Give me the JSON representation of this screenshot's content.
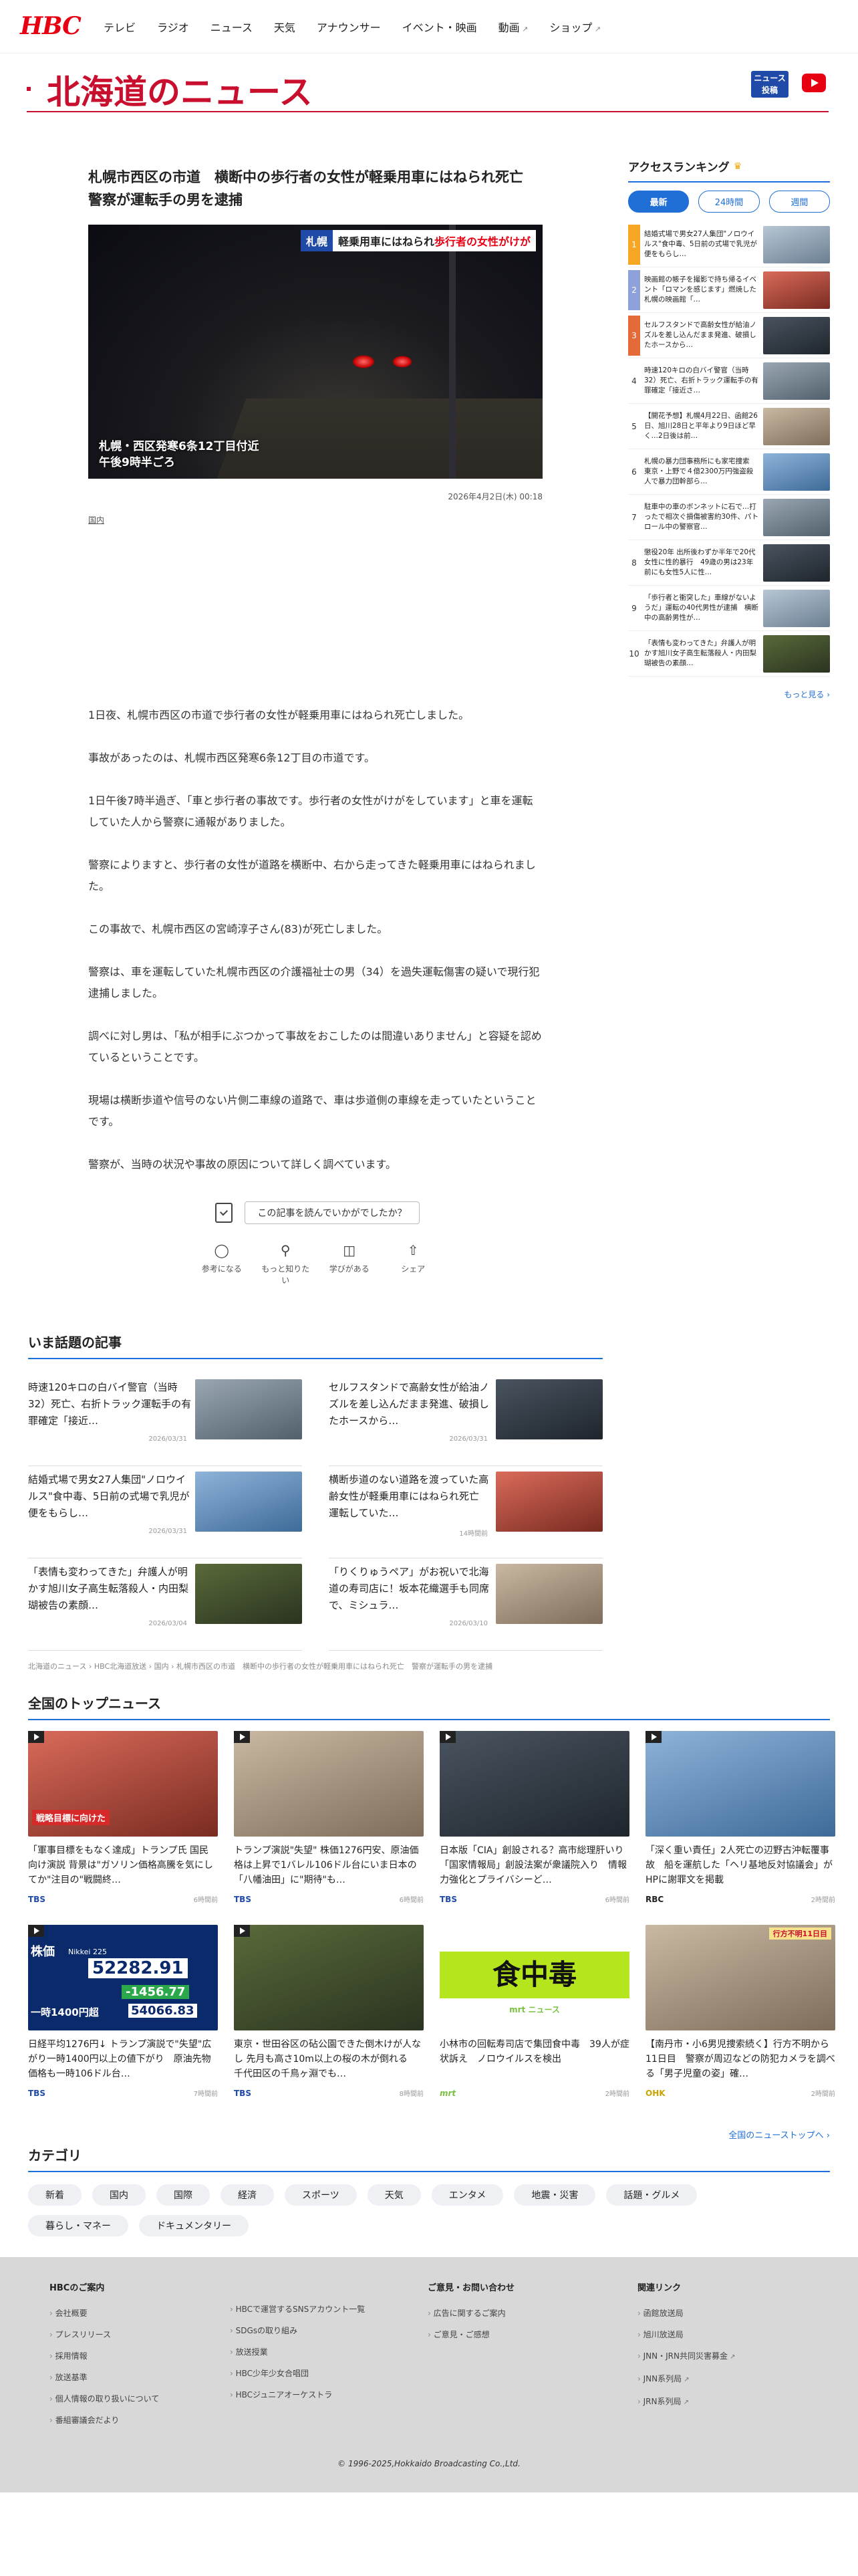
{
  "header": {
    "logo": "HBC",
    "nav": [
      "テレビ",
      "ラジオ",
      "ニュース",
      "天気",
      "アナウンサー",
      "イベント・映画",
      "動画",
      "ショップ"
    ]
  },
  "section_title": "北海道のニュース",
  "news_post_button": "ニュース\n投稿",
  "article": {
    "headline": "札幌市西区の市道　横断中の歩行者の女性が軽乗用車にはねられ死亡　警察が運転手の男を逮捕",
    "image": {
      "tag_area": "札幌",
      "tag_text_1": "軽乗用車にはねられ",
      "tag_text_2": "歩行者の女性がけが",
      "location_line1": "札幌・西区発寒6条12丁目付近",
      "location_line2": "午後9時半ごろ"
    },
    "published": "2026年4月2日(木) 00:18",
    "category": "国内",
    "paragraphs": [
      "1日夜、札幌市西区の市道で歩行者の女性が軽乗用車にはねられ死亡しました。",
      "事故があったのは、札幌市西区発寒6条12丁目の市道です。",
      "1日午後7時半過ぎ、「車と歩行者の事故です。歩行者の女性がけがをしています」と車を運転していた人から警察に通報がありました。",
      "警察によりますと、歩行者の女性が道路を横断中、右から走ってきた軽乗用車にはねられました。",
      "この事故で、札幌市西区の宮崎淳子さん(83)が死亡しました。",
      "警察は、車を運転していた札幌市西区の介護福祉士の男（34）を過失運転傷害の疑いで現行犯逮捕しました。",
      "調べに対し男は、「私が相手にぶつかって事故をおこしたのは間違いありません」と容疑を認めているということです。",
      "現場は横断歩道や信号のない片側二車線の道路で、車は歩道側の車線を走っていたということです。",
      "警察が、当時の状況や事故の原因について詳しく調べています。"
    ]
  },
  "reaction": {
    "question": "この記事を読んでいかがでしたか？",
    "buttons": [
      "参考になる",
      "もっと知りたい",
      "学びがある",
      "シェア"
    ]
  },
  "ranking": {
    "title": "アクセスランキング",
    "tabs": [
      "最新",
      "24時間",
      "週間"
    ],
    "items": [
      {
        "rank": "1",
        "text": "結婚式場で男女27人集団\"ノロウイルス\"食中毒、5日前の式場で乳児が便をもらし…"
      },
      {
        "rank": "2",
        "text": "映画館の帳子を撮影で持ち帰るイベント「ロマンを感じます」燃焼した札幌の映画館「…"
      },
      {
        "rank": "3",
        "text": "セルフスタンドで高齢女性が給油ノズルを差し込んだまま発進、破損したホースから…"
      },
      {
        "rank": "4",
        "text": "時速120キロの白バイ警官（当時32）死亡、右折トラック運転手の有罪確定「接近さ…"
      },
      {
        "rank": "5",
        "text": "【開花予想】札幌4月22日、函館26日、旭川28日と平年より9日ほど早く…2日後は前…"
      },
      {
        "rank": "6",
        "text": "札幌の暴力団事務所にも家宅捜索　東京・上野で４億2300万円強盗殺人で暴力団幹部ら…"
      },
      {
        "rank": "7",
        "text": "駐車中の車のボンネットに石で…打ったで相次ぐ損傷被害約30件、パトロール中の警察官…"
      },
      {
        "rank": "8",
        "text": "懲役20年 出所後わずか半年で20代女性に性的暴行　49歳の男は23年前にも女性5人に性…"
      },
      {
        "rank": "9",
        "text": "「歩行者と衝突した」車線がないようだ」運転の40代男性が逮捕　横断中の高齢男性が…"
      },
      {
        "rank": "10",
        "text": "「表情も変わってきた」弁護人が明かす旭川女子高生転落殺人・内田梨瑚被告の素顔…"
      }
    ],
    "more": "もっと見る"
  },
  "trending": {
    "title": "いま話題の記事",
    "items": [
      {
        "text": "時速120キロの白バイ警官（当時32）死亡、右折トラック運転手の有罪確定「接近…",
        "date": "2026/03/31"
      },
      {
        "text": "セルフスタンドで高齢女性が給油ノズルを差し込んだまま発進、破損したホースから…",
        "date": "2026/03/31"
      },
      {
        "text": "結婚式場で男女27人集団\"ノロウイルス\"食中毒、5日前の式場で乳児が便をもらし…",
        "date": "2026/03/31"
      },
      {
        "text": "横断歩道のない道路を渡っていた高齢女性が軽乗用車にはねられ死亡　運転していた…",
        "date": "14時間前"
      },
      {
        "text": "「表情も変わってきた」弁護人が明かす旭川女子高生転落殺人・内田梨瑚被告の素顔…",
        "date": "2026/03/04"
      },
      {
        "text": "「りくりゅうペア」がお祝いで北海道の寿司店に！坂本花織選手も同席で、ミシュラ…",
        "date": "2026/03/10"
      }
    ]
  },
  "breadcrumb": [
    "北海道のニュース",
    "HBC北海道放送",
    "国内",
    "札幌市西区の市道　横断中の歩行者の女性が軽乗用車にはねられ死亡　警察が運転手の男を逮捕"
  ],
  "national": {
    "title": "全国のトップニュース",
    "items": [
      {
        "text": "「軍事目標をもなく達成」トランプ氏 国民向け演説 背景は\"ガソリン価格高騰を気にしてか\"注目の\"戦闘終…",
        "source": "TBS",
        "ago": "6時間前"
      },
      {
        "text": "トランプ演説\"失望\" 株価1276円安、原油価格は上昇で1バレル106ドル台にいま日本の「八幡油田」に\"期待\"も…",
        "source": "TBS",
        "ago": "6時間前"
      },
      {
        "text": "日本版「CIA」創設される？高市総理肝いり「国家情報局」創設法案が衆議院入り　情報力強化とプライバシーど…",
        "source": "TBS",
        "ago": "6時間前"
      },
      {
        "text": "「深く重い責任」2人死亡の辺野古沖転覆事故　船を運航した「ヘリ基地反対協議会」がHPに謝罪文を掲載",
        "source": "RBC",
        "ago": "2時間前"
      },
      {
        "text": "日経平均1276円↓ トランプ演説で\"失望\"広がり一時1400円以上の値下がり　原油先物価格も一時106ドル台…",
        "source": "TBS",
        "ago": "7時間前"
      },
      {
        "text": "東京・世田谷区の砧公園できた倒木けが人なし 先月も高さ10m以上の桜の木が倒れる　千代田区の千鳥ヶ淵でも…",
        "source": "TBS",
        "ago": "8時間前"
      },
      {
        "text": "小林市の回転寿司店で集団食中毒　39人が症状訴え　ノロウイルスを検出",
        "source": "mrt",
        "ago": "2時間前"
      },
      {
        "text": "【南丹市・小6男児捜索続く】行方不明から11日目　警察が周辺などの防犯カメラを調べる「男子児童の姿」確…",
        "source": "OHK",
        "ago": "2時間前"
      }
    ],
    "thumb_text": {
      "n1": "戦略目標に向けた",
      "n5_title": "株価",
      "n5_nikkei": "Nikkei 225",
      "n5_value": "52282.91",
      "n5_change": "-1456.77",
      "n5_low": "一時1400円超",
      "n5_low_value": "54066.83",
      "n7_big": "食中毒",
      "n7_brand": "mrt ニュース",
      "n8_tag": "行方不明11日目"
    },
    "more": "全国のニューストップへ"
  },
  "categories": {
    "title": "カテゴリ",
    "items": [
      "新着",
      "国内",
      "国際",
      "経済",
      "スポーツ",
      "天気",
      "エンタメ",
      "地震・災害",
      "話題・グルメ",
      "暮らし・マネー",
      "ドキュメンタリー"
    ]
  },
  "footer": {
    "col1": {
      "title": "HBCのご案内",
      "items": [
        "会社概要",
        "プレスリリース",
        "採用情報",
        "放送基準",
        "個人情報の取り扱いについて",
        "番組審議会だより"
      ]
    },
    "col2": {
      "title": "",
      "items": [
        "HBCで運営するSNSアカウント一覧",
        "SDGsの取り組み",
        "放送授業",
        "HBC少年少女合唱団",
        "HBCジュニアオーケストラ"
      ]
    },
    "col3": {
      "title": "ご意見・お問い合わせ",
      "items": [
        "広告に関するご案内",
        "ご意見・ご感想"
      ]
    },
    "col4": {
      "title": "関連リンク",
      "items": [
        "函館放送局",
        "旭川放送局",
        "JNN・JRN共同災害募金",
        "JNN系列局",
        "JRN系列局"
      ]
    },
    "copyright": "© 1996-2025,Hokkaido Broadcasting Co.,Ltd."
  }
}
